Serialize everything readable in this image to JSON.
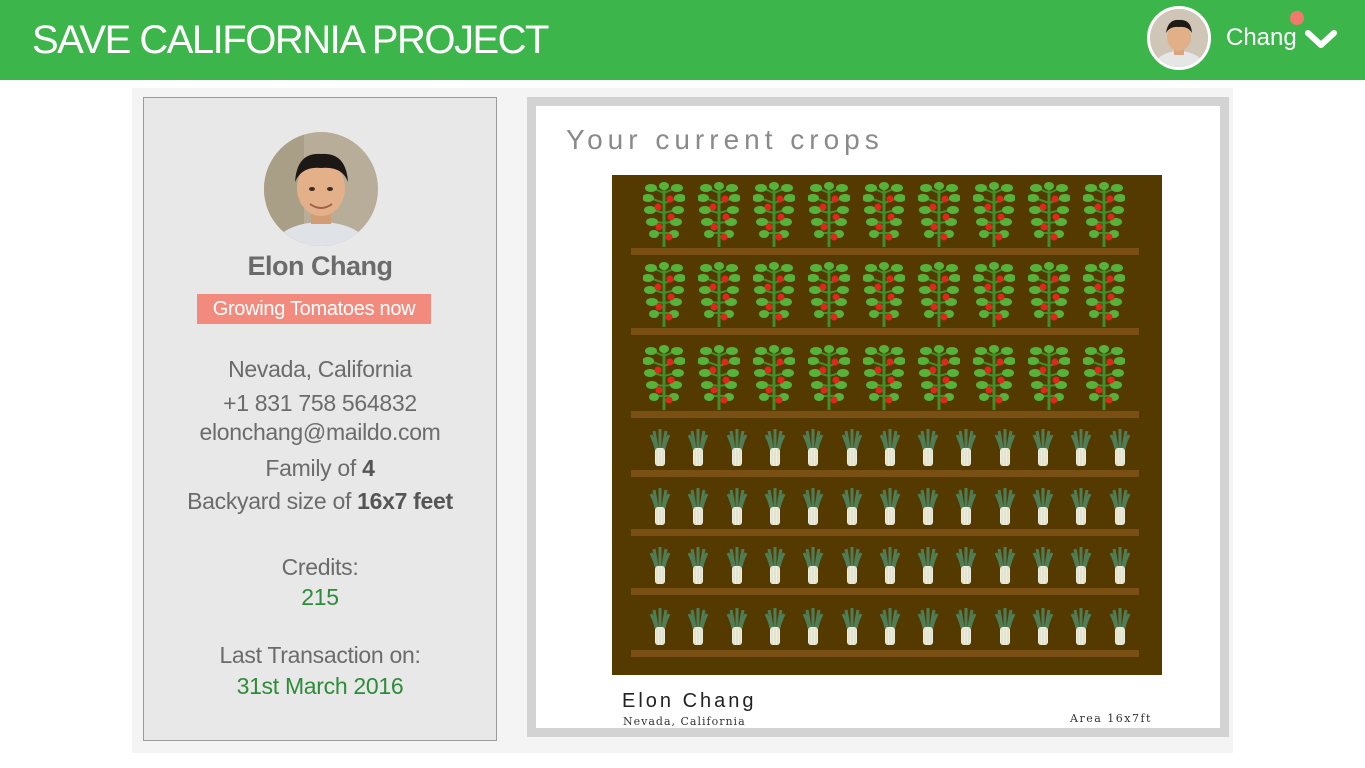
{
  "header": {
    "app_title": "SAVE CALIFORNIA PROJECT",
    "user_name": "Chang",
    "brand_color": "#3cb54a",
    "notification_color": "#f27a6a"
  },
  "profile": {
    "name": "Elon Chang",
    "status": "Growing Tomatoes now",
    "location": "Nevada, California",
    "phone": "+1 831 758 564832",
    "email": "elonchang@maildo.com",
    "family_prefix": "Family of ",
    "family_value": "4",
    "backyard_prefix": "Backyard size of ",
    "backyard_value": "16x7 feet",
    "credits_label": "Credits:",
    "credits_value": "215",
    "last_transaction_label": "Last Transaction on:",
    "last_transaction_value": "31st March 2016"
  },
  "crops": {
    "title": "Your current crops",
    "owner_name": "Elon Chang",
    "owner_location": "Nevada, California",
    "area": "Area 16x7ft",
    "rows": [
      {
        "crop": "tomato-plant",
        "count": 9
      },
      {
        "crop": "tomato-plant",
        "count": 9
      },
      {
        "crop": "tomato-plant",
        "count": 9
      },
      {
        "crop": "leek",
        "count": 13
      },
      {
        "crop": "leek",
        "count": 13
      },
      {
        "crop": "leek",
        "count": 13
      },
      {
        "crop": "leek",
        "count": 13
      }
    ]
  }
}
